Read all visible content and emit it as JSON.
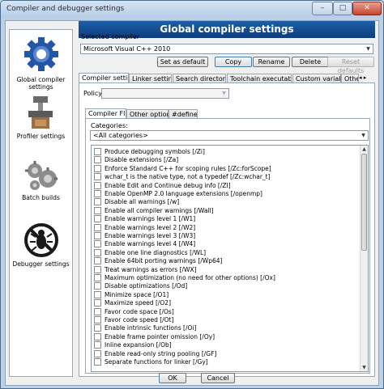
{
  "window": {
    "title": "Compiler and debugger settings",
    "min_glyph": "–",
    "max_glyph": "□",
    "close_glyph": "✕"
  },
  "sidebar": {
    "items": [
      {
        "label": "Global compiler settings",
        "icon": "gear-icon",
        "active": true
      },
      {
        "label": "Profiler settings",
        "icon": "profiler-icon",
        "active": false
      },
      {
        "label": "Batch builds",
        "icon": "batch-builds-icon",
        "active": false
      },
      {
        "label": "Debugger settings",
        "icon": "debugger-icon",
        "active": false
      }
    ]
  },
  "header": {
    "title": "Global compiler settings"
  },
  "compiler": {
    "label": "Selected compiler",
    "value": "Microsoft Visual C++ 2010",
    "buttons": {
      "set_default": "Set as default",
      "copy": "Copy",
      "rename": "Rename",
      "delete": "Delete",
      "reset": "Reset defaults"
    }
  },
  "tabs": [
    "Compiler settings",
    "Linker settings",
    "Search directories",
    "Toolchain executables",
    "Custom variables",
    "Other"
  ],
  "tab_scroll": {
    "left": "◂",
    "right": "▸"
  },
  "policy": {
    "label": "Policy:",
    "value": ""
  },
  "subtabs": [
    "Compiler Flags",
    "Other options",
    "#defines"
  ],
  "categories": {
    "label": "Categories:",
    "value": "<All categories>"
  },
  "flags": [
    "Produce debugging symbols  [/Zi]",
    "Disable extensions  [/Za]",
    "Enforce Standard C++ for scoping rules  [/Zc:forScope]",
    "wchar_t is the native type, not a typedef  [/Zc:wchar_t]",
    "Enable Edit and Continue debug info  [/ZI]",
    "Enable OpenMP 2.0 language extensions  [/openmp]",
    "Disable all warnings  [/w]",
    "Enable all compiler warnings  [/Wall]",
    "Enable warnings level 1  [/W1]",
    "Enable warnings level 2  [/W2]",
    "Enable warnings level 3  [/W3]",
    "Enable warnings level 4  [/W4]",
    "Enable one line diagnostics  [/WL]",
    "Enable 64bit porting warnings  [/Wp64]",
    "Treat warnings as errors  [/WX]",
    "Maximum optimization (no need for other options)  [/Ox]",
    "Disable optimizations  [/Od]",
    "Minimize space  [/O1]",
    "Maximize speed  [/O2]",
    "Favor code space  [/Os]",
    "Favor code speed  [/Ot]",
    "Enable intrinsic functions  [/Oi]",
    "Enable frame pointer omission  [/Oy]",
    "Inline expansion  [/Ob]",
    "Enable read-only string pooling  [/GF]",
    "Separate functions for linker  [/Gy]"
  ],
  "footer": {
    "ok": "OK",
    "cancel": "Cancel"
  },
  "colors": {
    "header_bg": "#1c5fa8",
    "window_frame": "#bcd0e6",
    "close_button": "#c4442c"
  }
}
